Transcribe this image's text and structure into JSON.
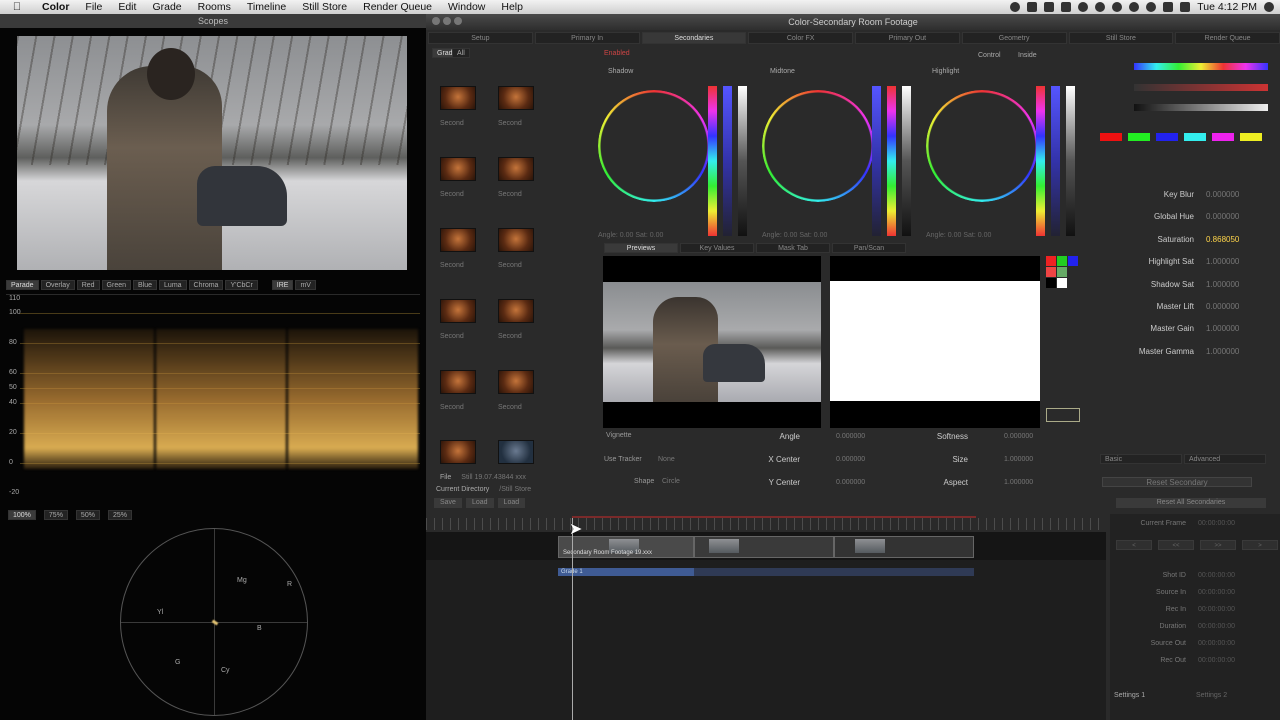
{
  "menubar": {
    "app": "Color",
    "items": [
      "File",
      "Edit",
      "Grade",
      "Rooms",
      "Timeline",
      "Still Store",
      "Render Queue",
      "Window",
      "Help"
    ],
    "clock": "Tue 4:12 PM"
  },
  "scopes": {
    "title": "Scopes",
    "tabs": [
      "Parade",
      "Overlay",
      "Red",
      "Green",
      "Blue",
      "Luma",
      "Chroma",
      "Y'CbCr"
    ],
    "tabs2": [
      "IRE",
      "mV"
    ],
    "wave_labels": [
      "110",
      "100",
      "80",
      "60",
      "50",
      "40",
      "20",
      "0",
      "-20"
    ],
    "zoom_tabs": [
      "100%",
      "75%",
      "50%",
      "25%"
    ],
    "vector_labels": [
      "R",
      "Mg",
      "B",
      "Cy",
      "G",
      "Yl"
    ]
  },
  "window": {
    "title": "Color-Secondary Room Footage"
  },
  "room_tabs": [
    "Setup",
    "Primary In",
    "Secondaries",
    "Color FX",
    "Primary Out",
    "Geometry",
    "Still Store",
    "Render Queue"
  ],
  "still_tabs": [
    "Grade",
    "All"
  ],
  "stills": {
    "captions": [
      "Second",
      "Second",
      "Second",
      "Second",
      "Second",
      "Second",
      "Second",
      "Second",
      "Second",
      "Second"
    ]
  },
  "file_info": {
    "file_label": "File",
    "file_value": "Still 19.07.43844 xxx",
    "dir_label": "Current Directory",
    "dir_value": "/Still Store"
  },
  "still_buttons": [
    "Save",
    "Load",
    "Load"
  ],
  "secondaries": {
    "enabled": "Enabled",
    "control": "Control",
    "inside": "Inside",
    "wheel_titles": [
      "Shadow",
      "Midtone",
      "Highlight"
    ],
    "wheel_stats": [
      "Angle: 0.00  Sat: 0.00",
      "Angle: 0.00  Sat: 0.00",
      "Angle: 0.00  Sat: 0.00"
    ]
  },
  "view_tabs": [
    "Previews",
    "Key Values",
    "Mask Tab",
    "Pan/Scan"
  ],
  "params": {
    "vignette": "Vignette",
    "use_tracker": "Use Tracker",
    "tracker_val": "None",
    "shape": "Shape",
    "shape_val": "Circle",
    "angle_label": "Angle",
    "angle_val": "0.000000",
    "xcenter_label": "X Center",
    "xcenter_val": "0.000000",
    "ycenter_label": "Y Center",
    "ycenter_val": "0.000000",
    "softness_label": "Softness",
    "softness_val": "0.000000",
    "size_label": "Size",
    "size_val": "1.000000",
    "aspect_label": "Aspect",
    "aspect_val": "1.000000"
  },
  "right_panel": {
    "rows": [
      {
        "label": "Key Blur",
        "value": "0.000000"
      },
      {
        "label": "Global Hue",
        "value": "0.000000"
      },
      {
        "label": "Saturation",
        "value": "0.868050"
      },
      {
        "label": "Highlight Sat",
        "value": "1.000000"
      },
      {
        "label": "Shadow Sat",
        "value": "1.000000"
      },
      {
        "label": "Master Lift",
        "value": "0.000000"
      },
      {
        "label": "Master Gain",
        "value": "1.000000"
      },
      {
        "label": "Master Gamma",
        "value": "1.000000"
      }
    ],
    "tabs": [
      "Basic",
      "Advanced"
    ],
    "btn1": "Reset Secondary",
    "btn2": "Reset All Secondaries"
  },
  "timeline": {
    "clip1": "Secondary Room Footage 19.xxx",
    "grade": "Grade 1"
  },
  "tc_panel": {
    "current_frame_label": "Current Frame",
    "current_frame_value": "00:00:00:00",
    "btns": [
      "<",
      "<<",
      ">>",
      ">"
    ],
    "rows": [
      {
        "label": "Shot ID",
        "value": "00:00:00:00"
      },
      {
        "label": "Source In",
        "value": "00:00:00:00"
      },
      {
        "label": "Rec In",
        "value": "00:00:00:00"
      },
      {
        "label": "Duration",
        "value": "00:00:00:00"
      },
      {
        "label": "Source Out",
        "value": "00:00:00:00"
      },
      {
        "label": "Rec Out",
        "value": "00:00:00:00"
      }
    ],
    "settings": "Settings 1",
    "settings2": "Settings 2"
  }
}
